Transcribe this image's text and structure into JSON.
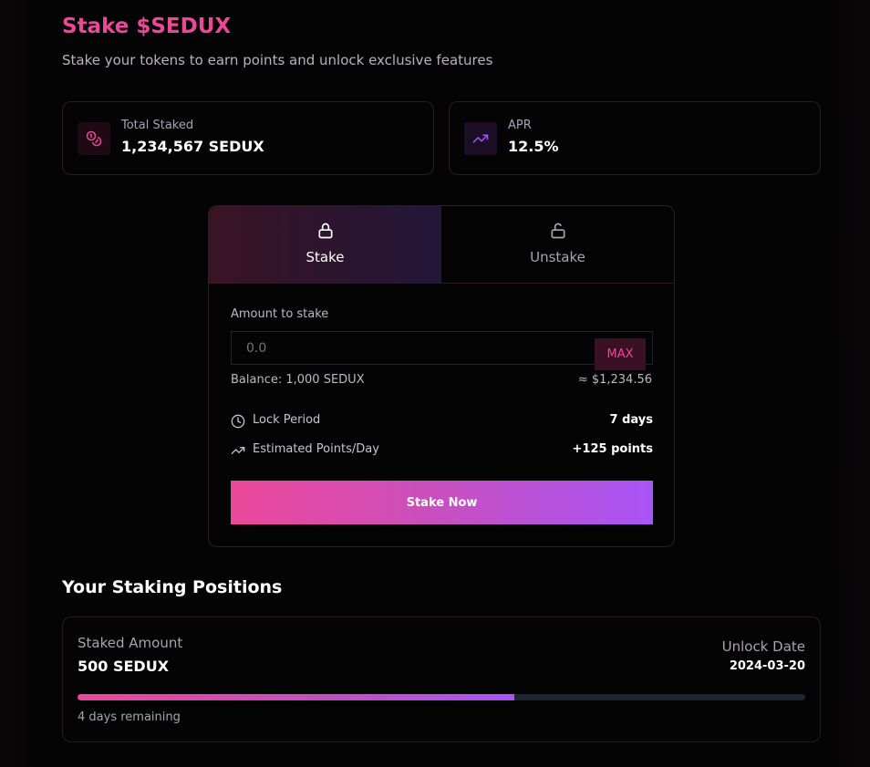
{
  "header": {
    "title": "Stake $SEDUX",
    "subtitle": "Stake your tokens to earn points and unlock exclusive features"
  },
  "stats": [
    {
      "label": "Total Staked",
      "value": "1,234,567 SEDUX",
      "icon": "coins-icon",
      "color": "#ec4899"
    },
    {
      "label": "APR",
      "value": "12.5%",
      "icon": "trending-up-icon",
      "color": "#a855f7"
    }
  ],
  "tabs": [
    {
      "label": "Stake",
      "icon": "lock-icon",
      "active": true
    },
    {
      "label": "Unstake",
      "icon": "unlock-icon",
      "active": false
    }
  ],
  "form": {
    "amount_label": "Amount to stake",
    "amount_placeholder": "0.0",
    "max_label": "MAX",
    "balance": "Balance: 1,000 SEDUX",
    "usd_value": "≈ $1,234.56",
    "lock_period_label": "Lock Period",
    "lock_period_value": "7 days",
    "points_label": "Estimated Points/Day",
    "points_value": "+125 points",
    "submit_label": "Stake Now"
  },
  "positions": {
    "section_title": "Your Staking Positions",
    "items": [
      {
        "amount_label": "Staked Amount",
        "amount": "500 SEDUX",
        "unlock_label": "Unlock Date",
        "unlock_date": "2024-03-20",
        "progress_percent": 60,
        "remaining": "4 days remaining"
      }
    ]
  },
  "colors": {
    "accent_pink": "#ec4899",
    "accent_purple": "#a855f7",
    "background": "#050405"
  }
}
